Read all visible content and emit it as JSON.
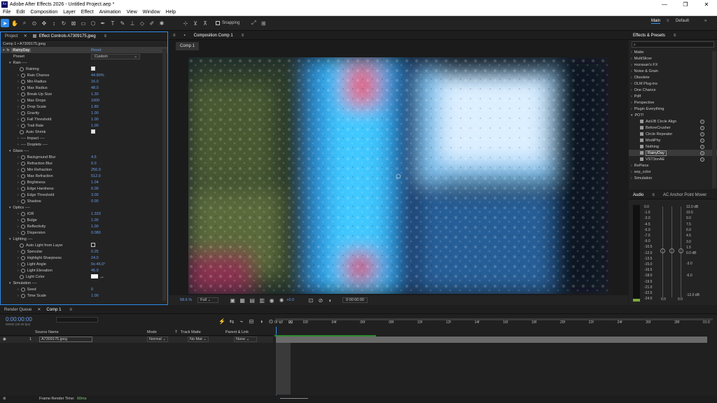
{
  "app": {
    "title": "Adobe After Effects 2026 - Untitled Project.aep *",
    "logo": "Ae"
  },
  "window_controls": {
    "minimize": "—",
    "restore": "❐",
    "close": "✕"
  },
  "menu": [
    "File",
    "Edit",
    "Composition",
    "Layer",
    "Effect",
    "Animation",
    "View",
    "Window",
    "Help"
  ],
  "toolbar": {
    "snapping_label": "Snapping",
    "workspaces": [
      "Main",
      "Default"
    ]
  },
  "left_panel": {
    "tabs": [
      "Project",
      "Effect Controls A7309175.jpeg"
    ],
    "breadcrumb": "Comp 1 • A7309175.jpeg",
    "effect_name": "RainyDay",
    "reset_label": "Reset",
    "preset_label": "Preset",
    "preset_value": "Custom",
    "rows": [
      {
        "label": "Rain ----",
        "value": "",
        "type": "group"
      },
      {
        "label": "Raining",
        "value": "",
        "type": "check",
        "checked": true
      },
      {
        "label": "Rain Chance",
        "value": "44.80%",
        "type": "prop"
      },
      {
        "label": "Min Radius",
        "value": "16.0",
        "type": "prop"
      },
      {
        "label": "Max Radius",
        "value": "48.0",
        "type": "prop"
      },
      {
        "label": "Break-Up Size",
        "value": "1.30",
        "type": "prop"
      },
      {
        "label": "Max Drops",
        "value": "1000",
        "type": "prop"
      },
      {
        "label": "Drop Scale",
        "value": "1.80",
        "type": "prop"
      },
      {
        "label": "Gravity",
        "value": "1.00",
        "type": "prop"
      },
      {
        "label": "Fall Threshold",
        "value": "1.00",
        "type": "prop"
      },
      {
        "label": "Trail Rate",
        "value": "1.00",
        "type": "prop"
      },
      {
        "label": "Auto Shrink",
        "value": "",
        "type": "check",
        "checked": true
      },
      {
        "label": "---- Impact ----",
        "value": "",
        "type": "sub"
      },
      {
        "label": "---- Droplets ----",
        "value": "",
        "type": "sub"
      },
      {
        "label": "Glass ----",
        "value": "",
        "type": "group"
      },
      {
        "label": "Background Blur",
        "value": "4.5",
        "type": "prop"
      },
      {
        "label": "Refraction Blur",
        "value": "6.0",
        "type": "prop"
      },
      {
        "label": "Min Refraction",
        "value": "256.0",
        "type": "prop"
      },
      {
        "label": "Max Refraction",
        "value": "512.0",
        "type": "prop"
      },
      {
        "label": "Brightness",
        "value": "1.04",
        "type": "prop"
      },
      {
        "label": "Edge Hardness",
        "value": "6.00",
        "type": "prop"
      },
      {
        "label": "Edge Threshold",
        "value": "3.00",
        "type": "prop"
      },
      {
        "label": "Shadow",
        "value": "0.00",
        "type": "prop"
      },
      {
        "label": "Optics ----",
        "value": "",
        "type": "group"
      },
      {
        "label": "IOR",
        "value": "1.333",
        "type": "prop"
      },
      {
        "label": "Bulge",
        "value": "1.00",
        "type": "prop"
      },
      {
        "label": "Reflectivity",
        "value": "1.00",
        "type": "prop"
      },
      {
        "label": "Dispersion",
        "value": "0.080",
        "type": "prop"
      },
      {
        "label": "Lighting ----",
        "value": "",
        "type": "group"
      },
      {
        "label": "Auto Light from Layer",
        "value": "",
        "type": "check",
        "checked": false
      },
      {
        "label": "Specular",
        "value": "0.25",
        "type": "prop"
      },
      {
        "label": "Highlight Sharpness",
        "value": "24.0",
        "type": "prop"
      },
      {
        "label": "Light Angle",
        "value": "0x-45.0°",
        "type": "prop"
      },
      {
        "label": "Light Elevation",
        "value": "45.0",
        "type": "prop"
      },
      {
        "label": "Light Color",
        "value": "",
        "type": "color"
      },
      {
        "label": "Simulation ----",
        "value": "",
        "type": "group"
      },
      {
        "label": "Seed",
        "value": "0",
        "type": "prop"
      },
      {
        "label": "Time Scale",
        "value": "1.00",
        "type": "prop"
      }
    ]
  },
  "comp_panel": {
    "tab": "Composition Comp 1",
    "sub_tab": "Comp 1",
    "zoom": "58.6 %",
    "resolution": "Full",
    "exposure": "+0.0",
    "timecode": "0:00:00:00"
  },
  "effects_panel": {
    "title": "Effects & Presets",
    "search_placeholder": "",
    "items": [
      {
        "label": "Matte",
        "sub": false
      },
      {
        "label": "MultiSlicer",
        "sub": false
      },
      {
        "label": "murasan's FX",
        "sub": false
      },
      {
        "label": "Noise & Grain",
        "sub": false
      },
      {
        "label": "Obsolete",
        "sub": false
      },
      {
        "label": "OLM Plug-ins",
        "sub": false
      },
      {
        "label": "One Chance",
        "sub": false
      },
      {
        "label": "Pdlf",
        "sub": false
      },
      {
        "label": "Perspective",
        "sub": false
      },
      {
        "label": "Plugin Everything",
        "sub": false
      },
      {
        "label": "POT!",
        "sub": false,
        "open": true
      },
      {
        "label": "AxiUB Circle Align",
        "sub": true
      },
      {
        "label": "BeforeCrusher",
        "sub": true
      },
      {
        "label": "Circle Repeater",
        "sub": true
      },
      {
        "label": "ModiPhy",
        "sub": true
      },
      {
        "label": "Nothing",
        "sub": true
      },
      {
        "label": "RainyDay",
        "sub": true,
        "selected": true
      },
      {
        "label": "VST3onAE",
        "sub": true
      },
      {
        "label": "RePiece",
        "sub": false
      },
      {
        "label": "sep_color",
        "sub": false
      },
      {
        "label": "Simulation",
        "sub": false
      }
    ]
  },
  "audio_panel": {
    "tabs": [
      "Audio",
      "AC Anchor Point Mover"
    ],
    "left_scale": [
      "0.0",
      "-1.5",
      "-3.0",
      "-4.5",
      "-6.0",
      "-7.5",
      "-9.0",
      "-10.5",
      "-12.0",
      "-13.5",
      "-15.0",
      "-16.5",
      "-18.0",
      "-19.5",
      "-21.0",
      "-22.5",
      "-24.0"
    ],
    "right_scale": [
      "12.0 dB",
      "10.5",
      "9.0",
      "7.5",
      "6.0",
      "4.5",
      "3.0",
      "1.5",
      "0.0 dB",
      "-3.0",
      "-6.0",
      "-12.0 dB"
    ],
    "zero_left": "0.0",
    "zero_right": "0.0"
  },
  "timeline": {
    "tabs": [
      "Render Queue",
      "Comp 1"
    ],
    "timecode": "0:00:00:00",
    "timecode_sub": "00000 (30.00 fps)",
    "columns": {
      "source": "Source Name",
      "mode": "Mode",
      "t": "T",
      "track_matte": "Track Matte",
      "parent": "Parent & Link"
    },
    "layer": {
      "num": "1",
      "name": "A7309175.jpeg",
      "mode": "Normal",
      "matte": "No Mat",
      "parent": "None"
    },
    "ruler": [
      "0f",
      "02f",
      "04f",
      "06f",
      "08f",
      "10f",
      "12f",
      "14f",
      "16f",
      "18f",
      "20f",
      "22f",
      "24f",
      "26f",
      "28f",
      "01:0"
    ],
    "render_time_label": "Frame Render Time:",
    "render_time_value": "60ms"
  }
}
